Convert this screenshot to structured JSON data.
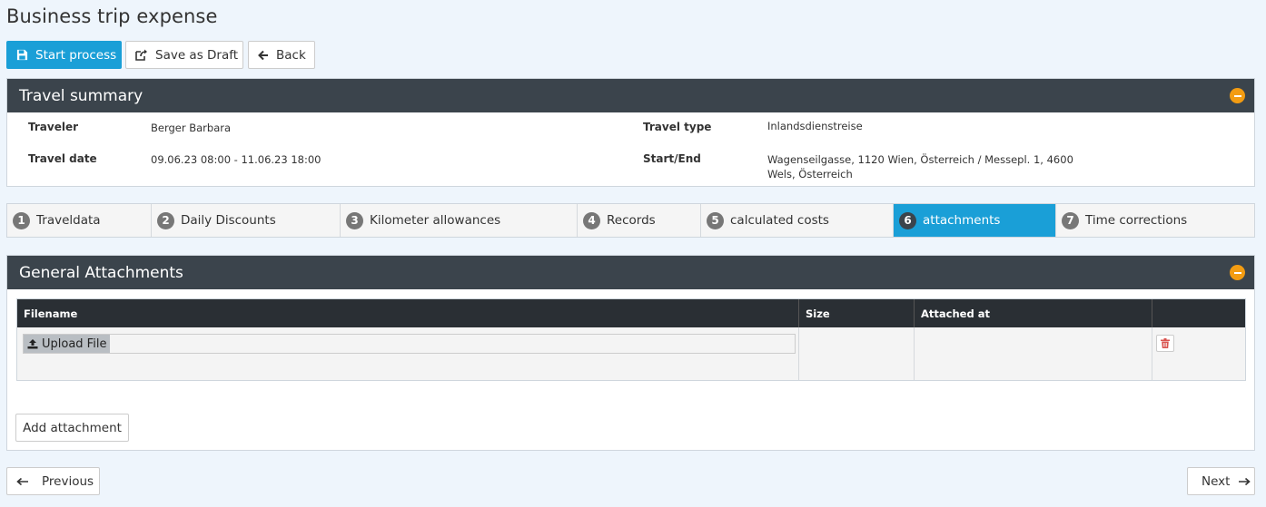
{
  "page": {
    "title": "Business trip expense"
  },
  "toolbar": {
    "start_label": "Start process",
    "draft_label": "Save as Draft",
    "back_label": "Back"
  },
  "summary": {
    "title": "Travel summary",
    "traveler_label": "Traveler",
    "traveler_value": "Berger Barbara",
    "date_label": "Travel date",
    "date_value": "09.06.23 08:00 - 11.06.23 18:00",
    "type_label": "Travel type",
    "type_value": "Inlandsdienstreise",
    "startend_label": "Start/End",
    "startend_line1": "Wagenseilgasse, 1120 Wien, Österreich / Messepl. 1, 4600",
    "startend_line2": "Wels, Österreich"
  },
  "tabs": [
    {
      "num": "1",
      "label": "Traveldata"
    },
    {
      "num": "2",
      "label": "Daily Discounts"
    },
    {
      "num": "3",
      "label": "Kilometer allowances"
    },
    {
      "num": "4",
      "label": "Records"
    },
    {
      "num": "5",
      "label": "calculated costs"
    },
    {
      "num": "6",
      "label": "attachments",
      "active": true
    },
    {
      "num": "7",
      "label": "Time corrections"
    }
  ],
  "attachments": {
    "title": "General Attachments",
    "columns": [
      "Filename",
      "Size",
      "Attached at",
      ""
    ],
    "upload_label": "Upload File",
    "add_label": "Add attachment"
  },
  "nav": {
    "previous_label": "Previous",
    "next_label": "Next"
  },
  "colors": {
    "primary": "#1a9fd7",
    "header": "#3b444c",
    "collapse": "#f39c12",
    "delete": "#d9534f"
  }
}
